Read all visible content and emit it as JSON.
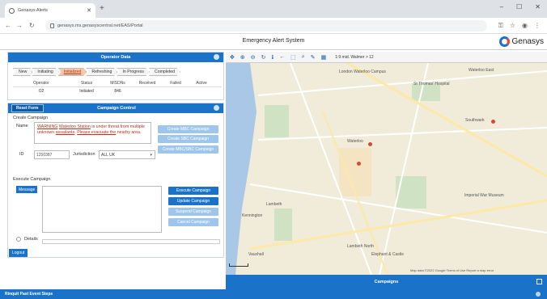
{
  "browser": {
    "tab_title": "Genasys Alerts",
    "url": "genasys.ms.genasyscentral.net/EAS/Portal"
  },
  "app": {
    "title": "Emergency Alert System",
    "logo_text": "Genasys"
  },
  "operator": {
    "title": "Operator Data",
    "phases": [
      "New",
      "Initiating",
      "Initialized",
      "Refreshing",
      "In Progress",
      "Completed"
    ],
    "active_phase": "Initialized",
    "table": {
      "headers": [
        "Operator",
        "Status",
        "MISDNs",
        "Received",
        "Failed",
        "Active"
      ],
      "rows": [
        [
          "O2",
          "Initiated",
          "846",
          "",
          "",
          ""
        ]
      ]
    }
  },
  "campaign_control": {
    "reset_label": "Reset Form",
    "title": "Campaign Control",
    "create_section": "Create Campaign",
    "name_label": "Name",
    "name_parts": [
      {
        "text": "WARNING",
        "underline": true
      },
      {
        "text": " ",
        "underline": false
      },
      {
        "text": "Waterloo Station",
        "underline": true
      },
      {
        "text": " is under threat from multiple unknown ",
        "underline": false
      },
      {
        "text": "assailants",
        "underline": true
      },
      {
        "text": ". ",
        "underline": false
      },
      {
        "text": "Please evacuate the",
        "underline": true
      },
      {
        "text": " nearby area.",
        "underline": false
      }
    ],
    "create_buttons": [
      "Create MBC Campaign",
      "Create SBC Campaign",
      "Create MBC/SBC Campaign"
    ],
    "id_label": "ID",
    "id_value": "1250387",
    "jurisdiction_label": "Jurisdiction",
    "jurisdiction_value": "ALL UK",
    "execute_section": "Execute Campaign",
    "message_label": "Message",
    "execute_buttons": [
      "Execute Campaign",
      "Update Campaign",
      "Suspend Campaign",
      "Cancel Campaign"
    ],
    "detail_label": "Details",
    "logout_label": "Logout"
  },
  "map": {
    "coords": "1:9 mid. Walmer > 12",
    "labels": [
      "London Waterloo Campus",
      "St Thomas' Hospital",
      "Waterloo",
      "Southwark",
      "Lambeth North",
      "Imperial War Museum",
      "Elephant & Castle",
      "Lambeth",
      "Kennington",
      "Vauxhall",
      "Waterloo East"
    ],
    "footer": "Map data ©2022 Google  Terms of Use  Report a map error"
  },
  "campaigns_bar": "Campaigns",
  "bottom_bar": "Rinquit Past Event Steps"
}
